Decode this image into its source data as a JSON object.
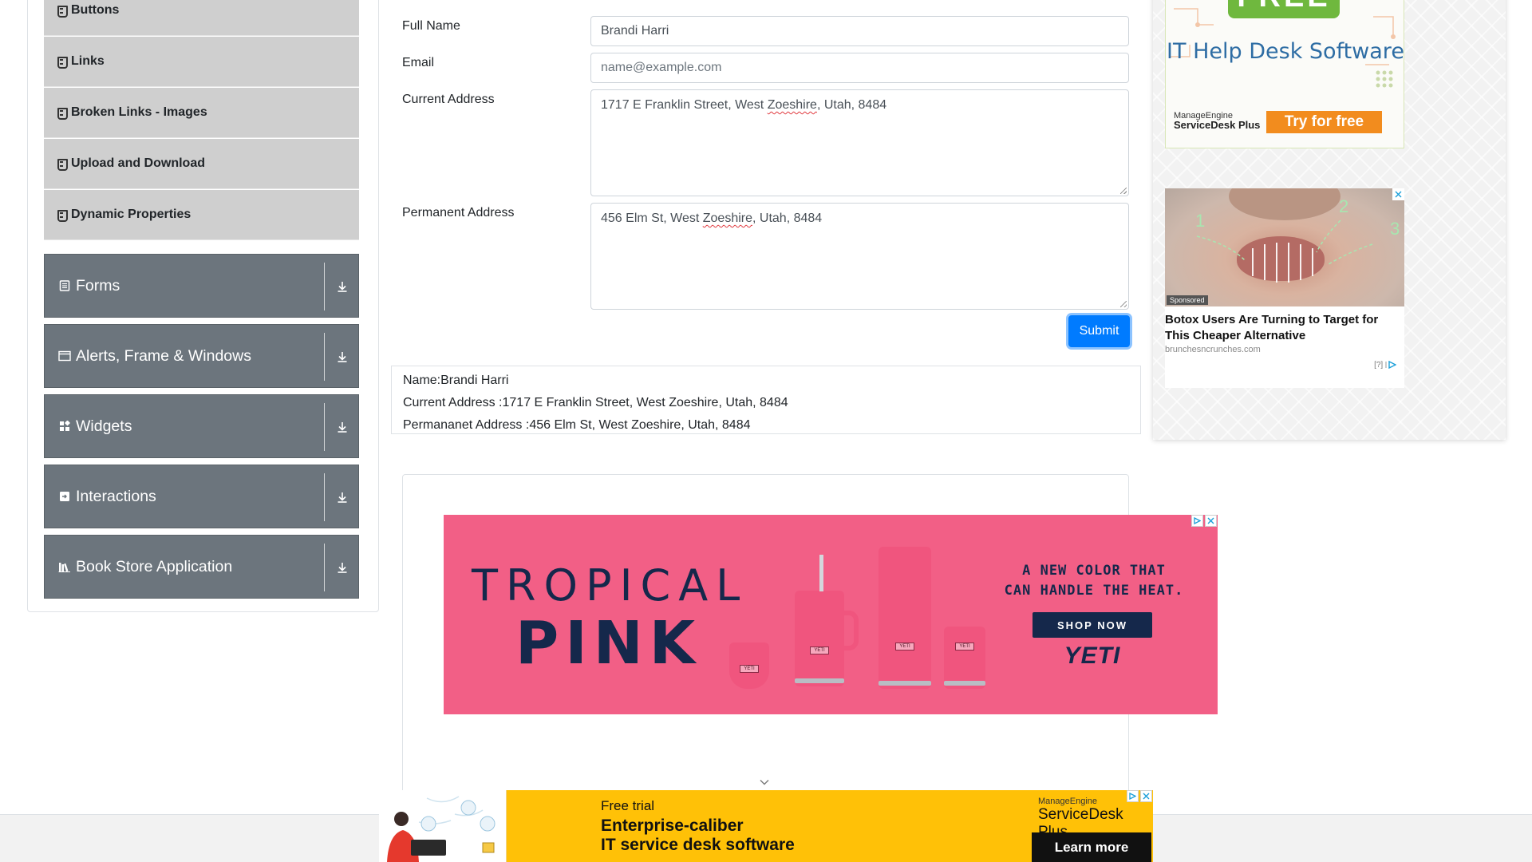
{
  "sidebar": {
    "elements_items": [
      {
        "label": "Buttons"
      },
      {
        "label": "Links"
      },
      {
        "label": "Broken Links - Images"
      },
      {
        "label": "Upload and Download"
      },
      {
        "label": "Dynamic Properties"
      }
    ],
    "groups": [
      {
        "label": "Forms",
        "icon": "form-icon"
      },
      {
        "label": "Alerts, Frame & Windows",
        "icon": "window-icon"
      },
      {
        "label": "Widgets",
        "icon": "widgets-icon"
      },
      {
        "label": "Interactions",
        "icon": "interactions-icon"
      },
      {
        "label": "Book Store Application",
        "icon": "books-icon"
      }
    ]
  },
  "form": {
    "full_name_label": "Full Name",
    "full_name_value": "Brandi Harri",
    "email_label": "Email",
    "email_placeholder": "name@example.com",
    "current_address_label": "Current Address",
    "current_address_pre": "1717 E Franklin Street, West ",
    "current_address_word": "Zoeshire",
    "current_address_post": ", Utah, 8484",
    "permanent_address_label": "Permanent Address",
    "permanent_address_pre": "456 Elm St, West ",
    "permanent_address_word": "Zoeshire",
    "permanent_address_post": ", Utah, 8484",
    "submit_label": "Submit"
  },
  "output": {
    "name": "Name:Brandi Harri",
    "current_address": "Current Address :1717 E Franklin Street, West Zoeshire, Utah, 8484",
    "permanent_address": "Permananet Address :456 Elm St, West Zoeshire, Utah, 8484"
  },
  "ads": {
    "yeti": {
      "tropical": "TROPICAL",
      "pink": "PINK",
      "headline_line1": "A NEW COLOR THAT",
      "headline_line2": "CAN HANDLE THE HEAT.",
      "shop_now": "SHOP NOW",
      "logo": "YETI",
      "cup_tag": "YETI"
    },
    "manageengine_side": {
      "free": "FREE",
      "title": "IT Help Desk Software",
      "brand_small": "ManageEngine",
      "brand_product": "ServiceDesk Plus",
      "cta": "Try for free"
    },
    "botox": {
      "sponsored": "Sponsored",
      "title": "Botox Users Are Turning to Target for This Cheaper Alternative",
      "source": "brunchesncrunches.com",
      "help": "[?]",
      "marks": [
        "1",
        "2",
        "3"
      ]
    },
    "manageengine_bottom": {
      "free_trial": "Free trial",
      "head_line1": "Enterprise-caliber",
      "head_line2": "IT service desk software",
      "brand_small": "ManageEngine",
      "brand_product": "ServiceDesk Plus",
      "cta": "Learn more"
    }
  },
  "colors": {
    "primary": "#007bff",
    "menu_group": "#6c757d",
    "menu_item": "#cfcfcf",
    "yeti_pink": "#f25f86",
    "yeti_navy": "#15284b",
    "bottom_ad": "#ffc107"
  }
}
